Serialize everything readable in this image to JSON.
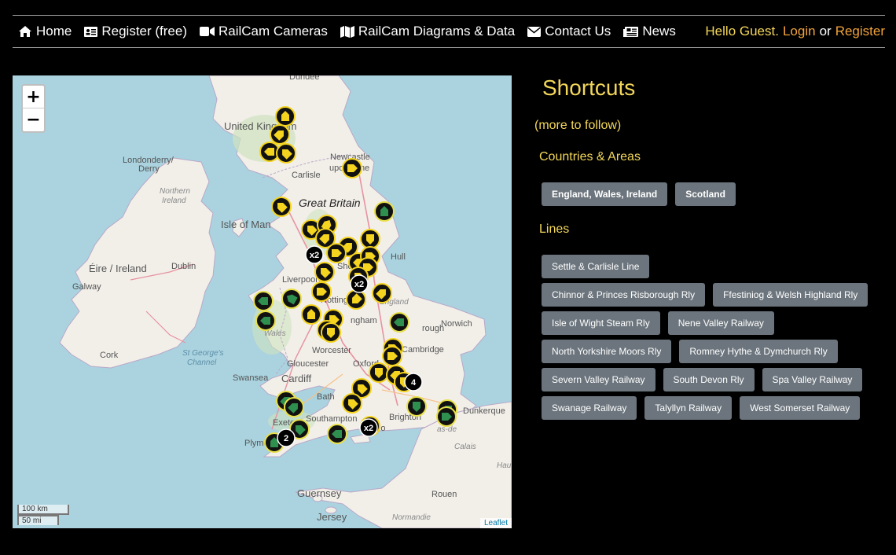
{
  "nav": {
    "items": [
      {
        "label": "Home",
        "icon": "home-icon"
      },
      {
        "label": "Register (free)",
        "icon": "id-card-icon"
      },
      {
        "label": "RailCam Cameras",
        "icon": "video-camera-icon"
      },
      {
        "label": "RailCam Diagrams & Data",
        "icon": "map-icon"
      },
      {
        "label": "Contact Us",
        "icon": "envelope-icon"
      },
      {
        "label": "News",
        "icon": "newspaper-icon"
      }
    ],
    "greeting": "Hello Guest.",
    "login": "Login",
    "or": "or",
    "register": "Register"
  },
  "map": {
    "zoom_in": "+",
    "zoom_out": "−",
    "scale_km": "100 km",
    "scale_mi": "50 mi",
    "attribution": "Leaflet",
    "labels": {
      "dundee": "Dundee",
      "united_kingdom": "United Kingdom",
      "londonderry": "Londonderry/",
      "derry": "Derry",
      "newcastle": "Newcastle",
      "upon_tyne": "upon Tyne",
      "carlisle": "Carlisle",
      "northern_ireland": "Northern",
      "ireland_ni": "Ireland",
      "great_britain": "Great Britain",
      "isle_of_man": "Isle of Man",
      "eire": "Éire / Ireland",
      "dublin": "Dublin",
      "galway": "Galway",
      "liverpool": "Liverpool",
      "hull": "Hull",
      "norwich": "Norwich",
      "cambridge": "Cambridge",
      "cork": "Cork",
      "st_georges": "St George's",
      "channel": "Channel",
      "worcester": "Worcester",
      "gloucester": "Gloucester",
      "oxford": "Oxford",
      "swansea": "Swansea",
      "cardiff": "Cardiff",
      "bath": "Bath",
      "southampton": "Southampton",
      "brighton": "Brighton",
      "exeter": "Exete",
      "plymouth": "Plymo",
      "dunkerque": "Dunkerque",
      "guernsey": "Guernsey",
      "jersey": "Jersey",
      "normandie": "Normandie",
      "wales": "Wales",
      "england": "England",
      "rouen": "Rouen",
      "nottingham": "Notting",
      "birmingham": "ngham",
      "peterborough": "rough",
      "sheffield": "Shef",
      "portsmouth": "Po",
      "pas_de_calais": "as-de",
      "calais": "Calais",
      "haut": "Haut"
    },
    "markers": {
      "badges": [
        "x2",
        "x2",
        "x2",
        "2",
        "4"
      ]
    }
  },
  "sidebar": {
    "title": "Shortcuts",
    "more": "(more to follow)",
    "countries_heading": "Countries & Areas",
    "countries": [
      "England, Wales, Ireland",
      "Scotland"
    ],
    "lines_heading": "Lines",
    "lines": [
      "Settle & Carlisle Line",
      "Chinnor & Princes Risborough Rly",
      "Ffestiniog & Welsh Highland Rly",
      "Isle of Wight Steam Rly",
      "Nene Valley Railway",
      "North Yorkshire Moors Rly",
      "Romney Hythe & Dymchurch Rly",
      "Severn Valley Railway",
      "South Devon Rly",
      "Spa Valley Railway",
      "Swanage Railway",
      "Talyllyn Railway",
      "West Somerset Railway"
    ]
  },
  "colors": {
    "accent_yellow": "#f3d75a",
    "link_orange": "#f2a33a",
    "chip_gray": "#6c757d",
    "sea": "#aad3df",
    "land": "#f2efe9",
    "marker_yellow": "#f4d41e",
    "marker_green": "#2f8f4e"
  }
}
